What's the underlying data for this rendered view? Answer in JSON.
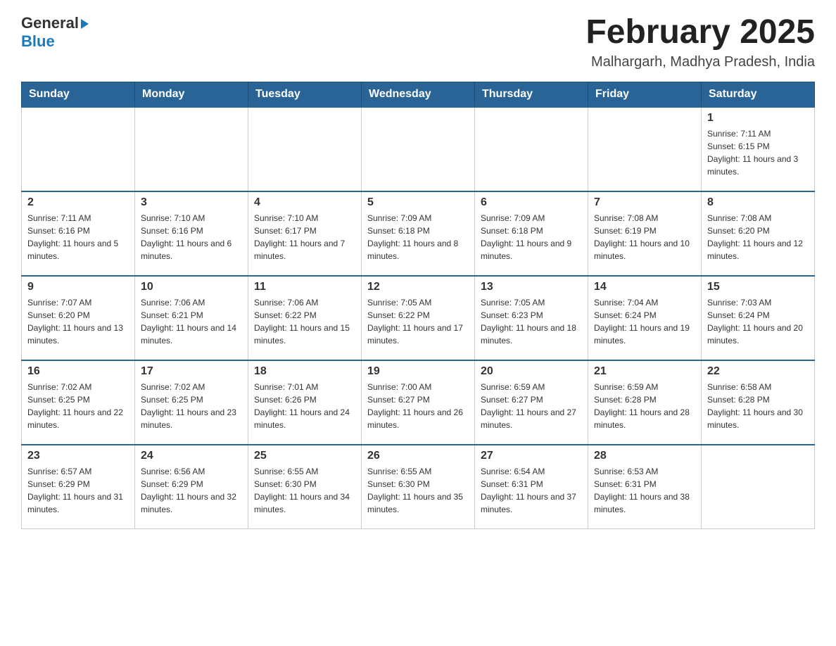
{
  "header": {
    "logo_general": "General",
    "logo_blue": "Blue",
    "month_title": "February 2025",
    "location": "Malhargarh, Madhya Pradesh, India"
  },
  "weekdays": [
    "Sunday",
    "Monday",
    "Tuesday",
    "Wednesday",
    "Thursday",
    "Friday",
    "Saturday"
  ],
  "weeks": [
    {
      "days": [
        {
          "date": "",
          "info": ""
        },
        {
          "date": "",
          "info": ""
        },
        {
          "date": "",
          "info": ""
        },
        {
          "date": "",
          "info": ""
        },
        {
          "date": "",
          "info": ""
        },
        {
          "date": "",
          "info": ""
        },
        {
          "date": "1",
          "info": "Sunrise: 7:11 AM\nSunset: 6:15 PM\nDaylight: 11 hours and 3 minutes."
        }
      ]
    },
    {
      "days": [
        {
          "date": "2",
          "info": "Sunrise: 7:11 AM\nSunset: 6:16 PM\nDaylight: 11 hours and 5 minutes."
        },
        {
          "date": "3",
          "info": "Sunrise: 7:10 AM\nSunset: 6:16 PM\nDaylight: 11 hours and 6 minutes."
        },
        {
          "date": "4",
          "info": "Sunrise: 7:10 AM\nSunset: 6:17 PM\nDaylight: 11 hours and 7 minutes."
        },
        {
          "date": "5",
          "info": "Sunrise: 7:09 AM\nSunset: 6:18 PM\nDaylight: 11 hours and 8 minutes."
        },
        {
          "date": "6",
          "info": "Sunrise: 7:09 AM\nSunset: 6:18 PM\nDaylight: 11 hours and 9 minutes."
        },
        {
          "date": "7",
          "info": "Sunrise: 7:08 AM\nSunset: 6:19 PM\nDaylight: 11 hours and 10 minutes."
        },
        {
          "date": "8",
          "info": "Sunrise: 7:08 AM\nSunset: 6:20 PM\nDaylight: 11 hours and 12 minutes."
        }
      ]
    },
    {
      "days": [
        {
          "date": "9",
          "info": "Sunrise: 7:07 AM\nSunset: 6:20 PM\nDaylight: 11 hours and 13 minutes."
        },
        {
          "date": "10",
          "info": "Sunrise: 7:06 AM\nSunset: 6:21 PM\nDaylight: 11 hours and 14 minutes."
        },
        {
          "date": "11",
          "info": "Sunrise: 7:06 AM\nSunset: 6:22 PM\nDaylight: 11 hours and 15 minutes."
        },
        {
          "date": "12",
          "info": "Sunrise: 7:05 AM\nSunset: 6:22 PM\nDaylight: 11 hours and 17 minutes."
        },
        {
          "date": "13",
          "info": "Sunrise: 7:05 AM\nSunset: 6:23 PM\nDaylight: 11 hours and 18 minutes."
        },
        {
          "date": "14",
          "info": "Sunrise: 7:04 AM\nSunset: 6:24 PM\nDaylight: 11 hours and 19 minutes."
        },
        {
          "date": "15",
          "info": "Sunrise: 7:03 AM\nSunset: 6:24 PM\nDaylight: 11 hours and 20 minutes."
        }
      ]
    },
    {
      "days": [
        {
          "date": "16",
          "info": "Sunrise: 7:02 AM\nSunset: 6:25 PM\nDaylight: 11 hours and 22 minutes."
        },
        {
          "date": "17",
          "info": "Sunrise: 7:02 AM\nSunset: 6:25 PM\nDaylight: 11 hours and 23 minutes."
        },
        {
          "date": "18",
          "info": "Sunrise: 7:01 AM\nSunset: 6:26 PM\nDaylight: 11 hours and 24 minutes."
        },
        {
          "date": "19",
          "info": "Sunrise: 7:00 AM\nSunset: 6:27 PM\nDaylight: 11 hours and 26 minutes."
        },
        {
          "date": "20",
          "info": "Sunrise: 6:59 AM\nSunset: 6:27 PM\nDaylight: 11 hours and 27 minutes."
        },
        {
          "date": "21",
          "info": "Sunrise: 6:59 AM\nSunset: 6:28 PM\nDaylight: 11 hours and 28 minutes."
        },
        {
          "date": "22",
          "info": "Sunrise: 6:58 AM\nSunset: 6:28 PM\nDaylight: 11 hours and 30 minutes."
        }
      ]
    },
    {
      "days": [
        {
          "date": "23",
          "info": "Sunrise: 6:57 AM\nSunset: 6:29 PM\nDaylight: 11 hours and 31 minutes."
        },
        {
          "date": "24",
          "info": "Sunrise: 6:56 AM\nSunset: 6:29 PM\nDaylight: 11 hours and 32 minutes."
        },
        {
          "date": "25",
          "info": "Sunrise: 6:55 AM\nSunset: 6:30 PM\nDaylight: 11 hours and 34 minutes."
        },
        {
          "date": "26",
          "info": "Sunrise: 6:55 AM\nSunset: 6:30 PM\nDaylight: 11 hours and 35 minutes."
        },
        {
          "date": "27",
          "info": "Sunrise: 6:54 AM\nSunset: 6:31 PM\nDaylight: 11 hours and 37 minutes."
        },
        {
          "date": "28",
          "info": "Sunrise: 6:53 AM\nSunset: 6:31 PM\nDaylight: 11 hours and 38 minutes."
        },
        {
          "date": "",
          "info": ""
        }
      ]
    }
  ]
}
